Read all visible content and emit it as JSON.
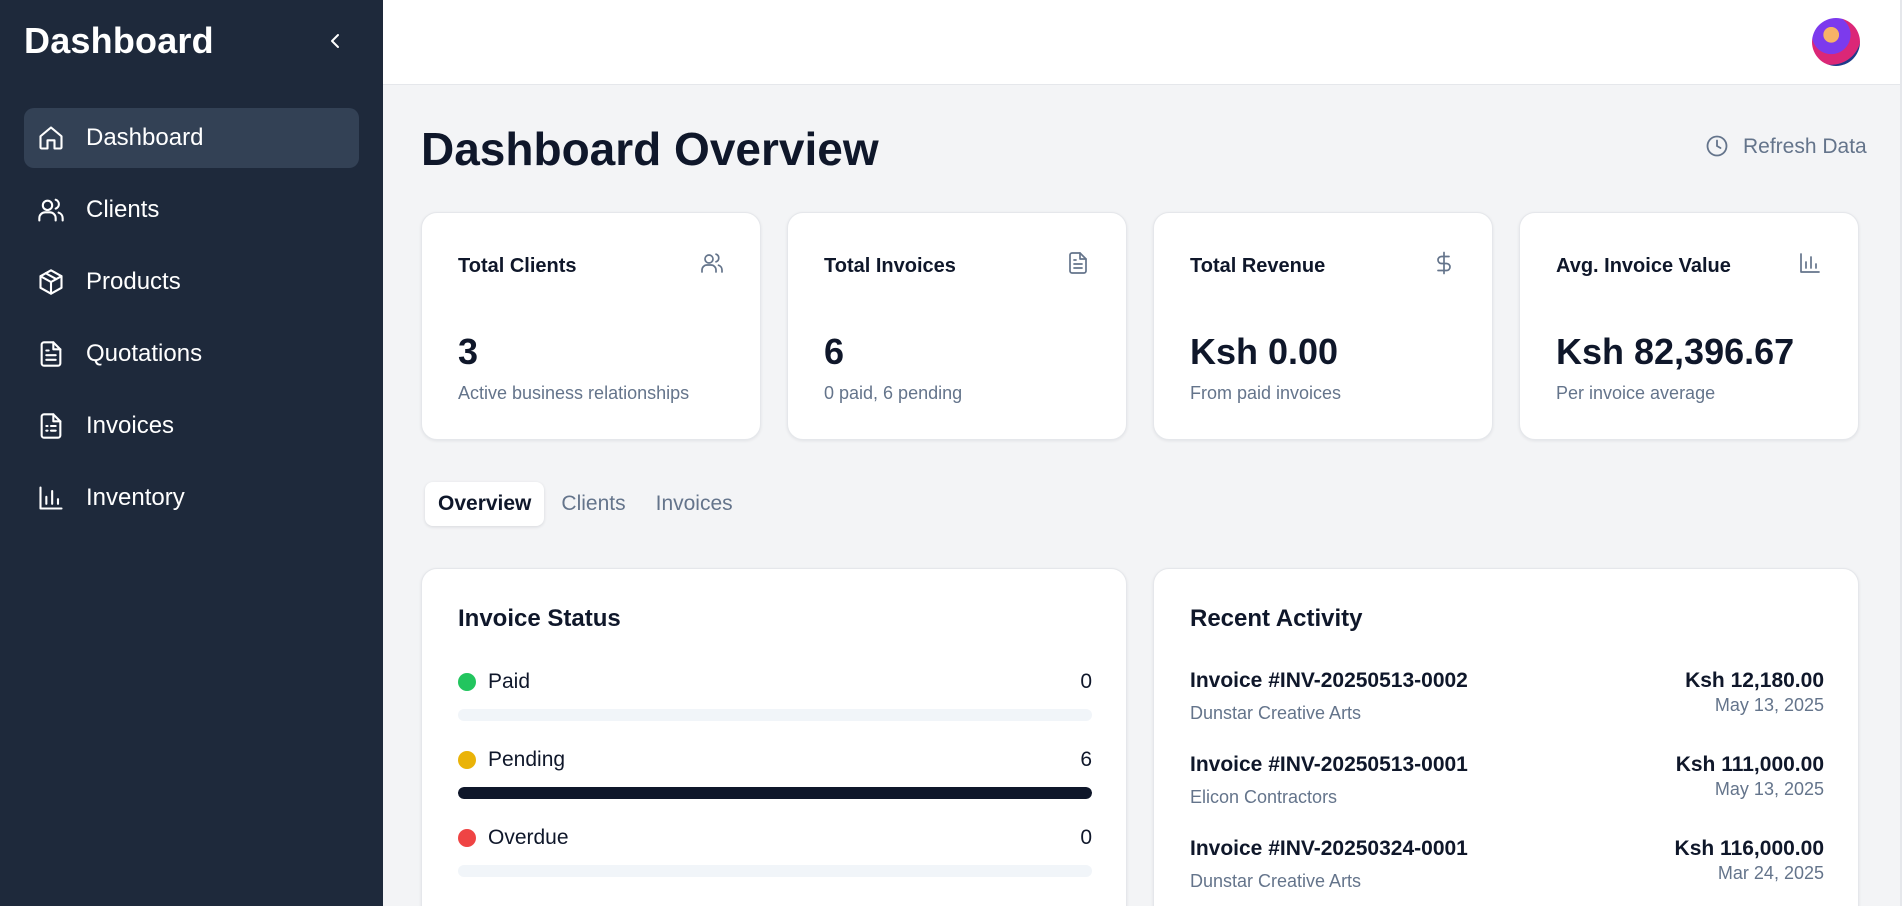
{
  "sidebar": {
    "brand": "Dashboard",
    "items": [
      {
        "label": "Dashboard",
        "icon": "home-icon",
        "active": true
      },
      {
        "label": "Clients",
        "icon": "users-icon"
      },
      {
        "label": "Products",
        "icon": "box-icon"
      },
      {
        "label": "Quotations",
        "icon": "document-icon"
      },
      {
        "label": "Invoices",
        "icon": "receipt-icon"
      },
      {
        "label": "Inventory",
        "icon": "bar-chart-icon"
      }
    ]
  },
  "header": {
    "title": "Dashboard Overview",
    "refresh_label": "Refresh Data"
  },
  "stats": [
    {
      "title": "Total Clients",
      "value": "3",
      "sub": "Active business relationships",
      "icon": "users-icon"
    },
    {
      "title": "Total Invoices",
      "value": "6",
      "sub": "0 paid, 6 pending",
      "icon": "document-icon"
    },
    {
      "title": "Total Revenue",
      "value": "Ksh 0.00",
      "sub": "From paid invoices",
      "icon": "dollar-icon"
    },
    {
      "title": "Avg. Invoice Value",
      "value": "Ksh 82,396.67",
      "sub": "Per invoice average",
      "icon": "bar-chart-icon"
    }
  ],
  "tabs": [
    {
      "label": "Overview",
      "active": true
    },
    {
      "label": "Clients"
    },
    {
      "label": "Invoices"
    }
  ],
  "invoice_status": {
    "title": "Invoice Status",
    "rows": [
      {
        "label": "Paid",
        "count": "0",
        "fraction": 0,
        "color": "#22c55e"
      },
      {
        "label": "Pending",
        "count": "6",
        "fraction": 1,
        "color": "#eab308"
      },
      {
        "label": "Overdue",
        "count": "0",
        "fraction": 0,
        "color": "#ef4444"
      }
    ]
  },
  "recent_activity": {
    "title": "Recent Activity",
    "items": [
      {
        "title": "Invoice #INV-20250513-0002",
        "client": "Dunstar Creative Arts",
        "amount": "Ksh 12,180.00",
        "date": "May 13, 2025"
      },
      {
        "title": "Invoice #INV-20250513-0001",
        "client": "Elicon Contractors",
        "amount": "Ksh 111,000.00",
        "date": "May 13, 2025"
      },
      {
        "title": "Invoice #INV-20250324-0001",
        "client": "Dunstar Creative Arts",
        "amount": "Ksh 116,000.00",
        "date": "Mar 24, 2025"
      }
    ]
  },
  "colors": {
    "sidebar_bg": "#1e293b",
    "sidebar_active": "#334155",
    "main_bg": "#f3f4f6",
    "accent_dark": "#0f172a"
  }
}
